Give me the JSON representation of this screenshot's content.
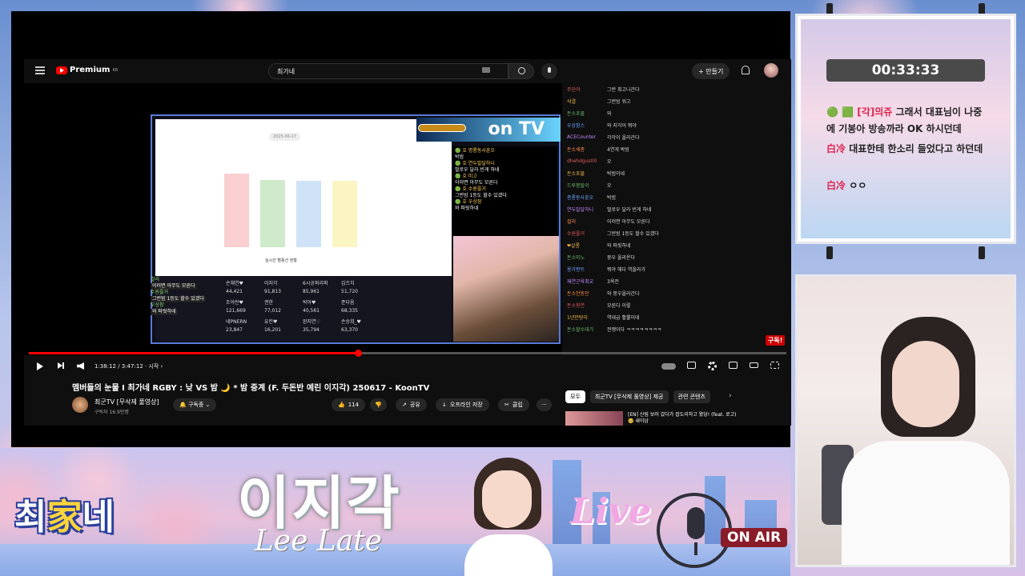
{
  "youtube": {
    "brand": "Premium",
    "brand_sup": "KR",
    "search_value": "최가네",
    "create_label": "+ 만들기",
    "inner_date": "2025-06-17",
    "inner_caption": "실시간 별풍선 현황",
    "inner_chat": [
      {
        "name": "🟢 호 명룡동사훈오",
        "msg": "박빔"
      },
      {
        "name": "🟢 호 연두발달하니",
        "msg": "벌로우 달라 빈게 하네"
      },
      {
        "name": "🟢 호 미고",
        "msg": "이러면 아무도 모른다"
      },
      {
        "name": "🟢 호 수원플거",
        "msg": "그런빔 1등도 할수 있겠다"
      },
      {
        "name": "🟢 호 우상참",
        "msg": "와 파릿하네"
      }
    ],
    "inner_overlay_chat": [
      {
        "name": "컬리",
        "msg": "이러면 아무도 모른다"
      },
      {
        "name": "수원플거",
        "msg": "그런빔 1등도 할수 있겠다"
      },
      {
        "name": "우상참",
        "msg": "와 파릿하네"
      }
    ],
    "inner_table": [
      [
        "손채연♥",
        "이지각",
        "6시공퍼리퍼",
        "김즈치"
      ],
      [
        "44,421",
        "91,813",
        "85,961",
        "51,720"
      ],
      [
        "조아란♥",
        "권한",
        "박아♥",
        "준다움"
      ],
      [
        "121,669",
        "77,012",
        "40,561",
        "68,335"
      ],
      [
        "네PNERN",
        "유린♥",
        "완지연♡",
        "손승희_♥"
      ],
      [
        "23,847",
        "16,201",
        "35,794",
        "63,370"
      ]
    ],
    "right_chat": [
      [
        "주단야",
        "그런 최고나간다"
      ],
      [
        "석결",
        "그런빔 워고"
      ],
      [
        "돈소초물",
        "와"
      ],
      [
        "우상참스",
        "와 지각이 뭐야"
      ],
      [
        "ACECounter",
        "각각이 올라간다"
      ],
      [
        "돈소세종",
        "4연게 박빔"
      ],
      [
        "dhehdgus00",
        "오"
      ],
      [
        "돈소초물",
        "박빔이네"
      ],
      [
        "드루붕탈이",
        "오"
      ],
      [
        "종룡동사훈오",
        "박빔"
      ],
      [
        "연두발달하니",
        "벌로우 달라 빈게 하네"
      ],
      [
        "컬리",
        "이러면 아무도 모른다"
      ],
      [
        "수원플거",
        "그런빔 1등도 할수 있겠다"
      ],
      [
        "❤살롱",
        "와 파릿하네"
      ],
      [
        "돈소미노",
        "뭉우 올라온다"
      ],
      [
        "용가펀트",
        "뭐야 해다 역올라가"
      ],
      [
        "재연근육최교",
        "3옥전"
      ],
      [
        "돈소안동인",
        "와 뭉우올라간다"
      ],
      [
        "돈소향연",
        "모른다 이렇"
      ],
      [
        "1년만탕이",
        "역대급 활뿔이네"
      ],
      [
        "돈소할수대기",
        "전쟁이다 ㅋㅋㅋㅋㅋㅋㅋㅋ"
      ]
    ],
    "chat_colors": [
      "#e45d5d",
      "#f2b84b",
      "#6dbb6d",
      "#6aa6ff",
      "#c58bff",
      "#ff8c4d"
    ],
    "subscribe_badge": "구독!",
    "time": "1:38:12 / 3:47:12 · 시작 ›",
    "progress": 0.434,
    "video_title": "멤버들의 눈물 I 최가네 RGBY : 낮 VS 밤 🌙 * 밤 중계 (F. 두돈반 예린 이지각) 250617 - KoonTV",
    "channel_name": "최군TV [무삭제 풀영상]",
    "channel_subs": "구독자 16.9만명",
    "subscribe_label": "🔔 구독중 ⌄",
    "like_count": "114",
    "share_label": "공유",
    "offline_label": "오프라인 저장",
    "clip_label": "클립",
    "more_label": "···",
    "side_tabs": [
      "모두",
      "최군TV [무삭제 풀영상] 제공",
      "관련 콘텐츠"
    ],
    "side_next": "›",
    "side_video_title": "[EN] 신림 보러 갔다가 잡도리하고 왔당! (feat. 로고) 🥺 새이남"
  },
  "stream_chat": {
    "timer": "00:33:33",
    "messages": [
      {
        "name": "🟢 🟩 [각]의쥬",
        "text": "그래서 대표님이 나중에 기봉아 방송까라 OK 하시던데"
      },
      {
        "name": "白冷",
        "text": "대표한테 한소리 들었다고 하던데"
      },
      {
        "name": "白冷",
        "text": "ㅇㅇ"
      }
    ]
  },
  "banner": {
    "logo_pre": "최",
    "logo_mid": "家",
    "logo_post": "네",
    "streamer_kr": "이지각",
    "streamer_en": "Lee Late",
    "live": "Live",
    "on_air": "ON AIR"
  },
  "chart_bar_colors": [
    "#f9cfd1",
    "#cfeacb",
    "#cfe2f7",
    "#fbf4c3"
  ],
  "chart_bar_values": [
    44499,
    40687,
    40359,
    40139
  ]
}
